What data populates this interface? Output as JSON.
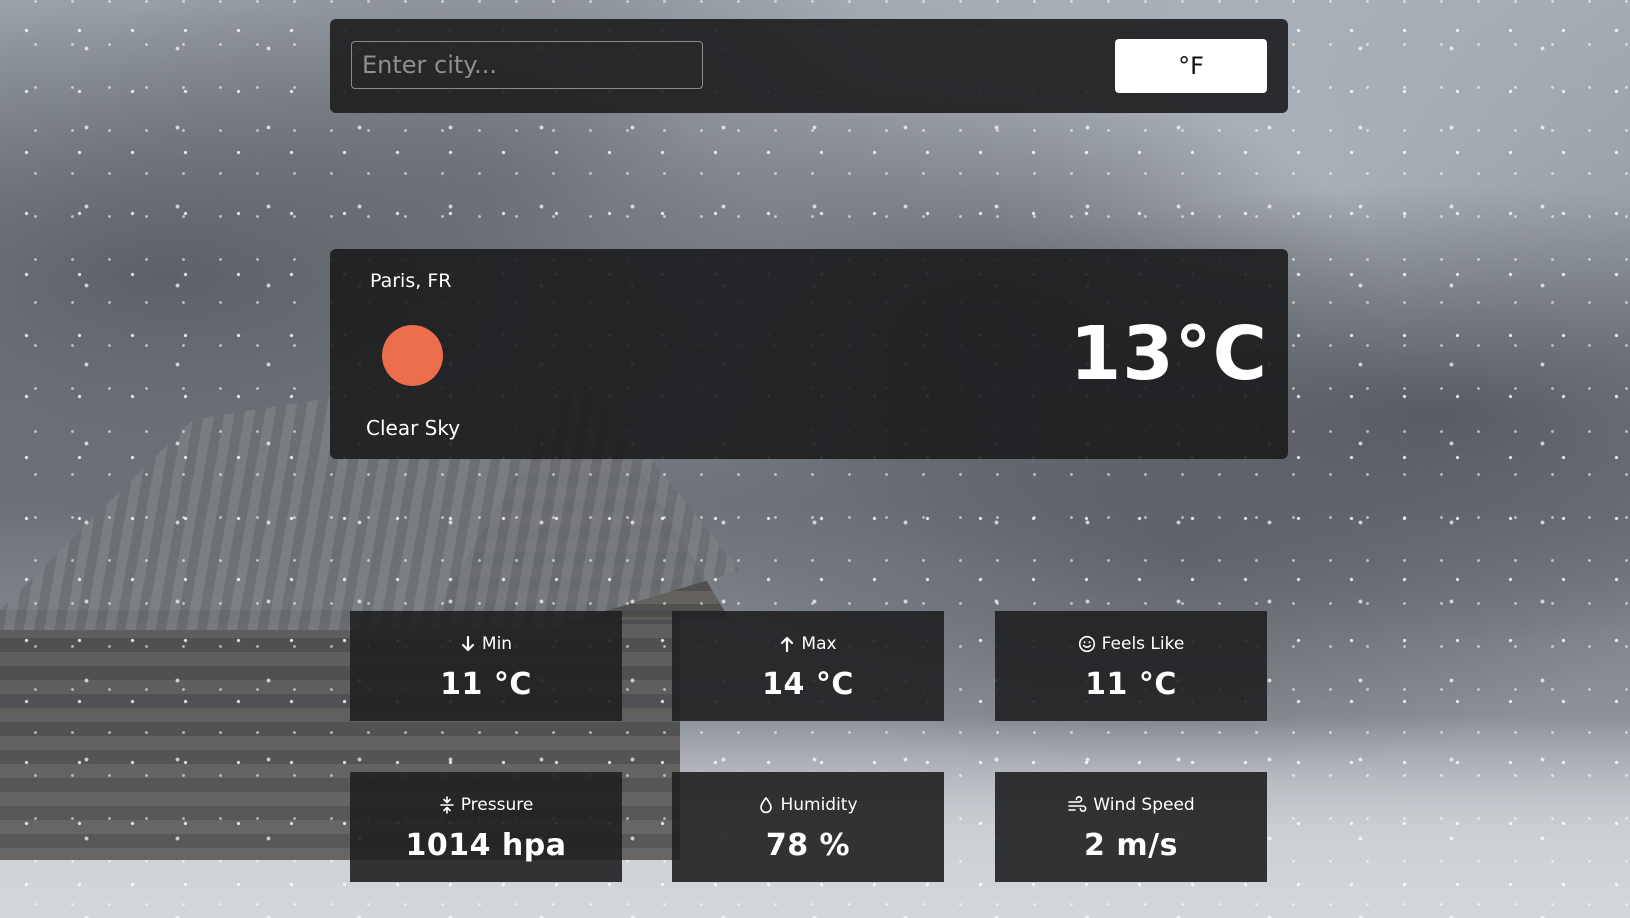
{
  "search": {
    "placeholder": "Enter city...",
    "value": ""
  },
  "unit_toggle": {
    "label": "°F"
  },
  "current": {
    "location": "Paris, FR",
    "condition": "Clear Sky",
    "temperature": "13°C",
    "icon": "sun-icon",
    "icon_color": "#ec6e4c"
  },
  "stats": [
    {
      "icon": "arrow-down-icon",
      "label": "Min",
      "value": "11 °C"
    },
    {
      "icon": "arrow-up-icon",
      "label": "Max",
      "value": "14 °C"
    },
    {
      "icon": "smiley-icon",
      "label": "Feels Like",
      "value": "11 °C"
    },
    {
      "icon": "pressure-icon",
      "label": "Pressure",
      "value": "1014 hpa"
    },
    {
      "icon": "droplet-icon",
      "label": "Humidity",
      "value": "78 %"
    },
    {
      "icon": "wind-icon",
      "label": "Wind Speed",
      "value": "2 m/s"
    }
  ],
  "colors": {
    "panel": "#202022",
    "text": "#ffffff",
    "button_bg": "#ffffff"
  }
}
